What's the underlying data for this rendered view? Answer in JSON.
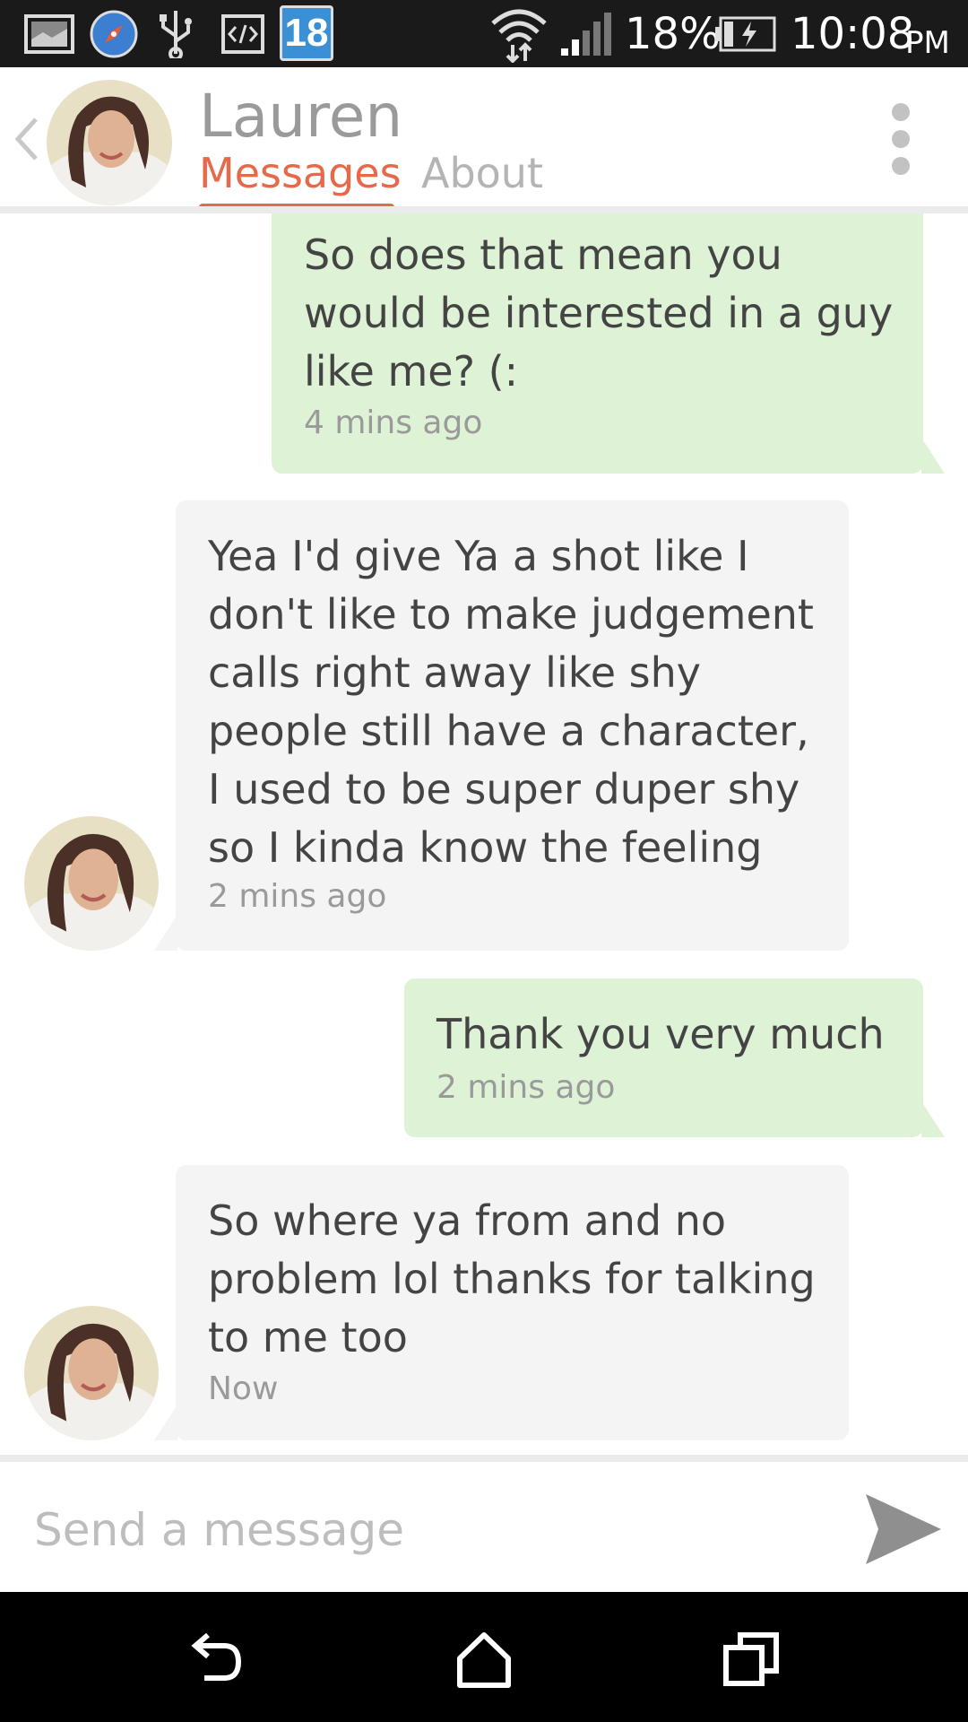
{
  "status_bar": {
    "notification_count": "18",
    "battery": "18%",
    "time": "10:08",
    "ampm": "PM"
  },
  "header": {
    "contact_name": "Lauren",
    "tabs": [
      {
        "label": "Messages",
        "active": true
      },
      {
        "label": "About",
        "active": false
      }
    ]
  },
  "messages": [
    {
      "direction": "sent",
      "text": "So does that mean you would be interested in a guy like me? (:",
      "time": "4 mins ago"
    },
    {
      "direction": "received",
      "text": "Yea I'd give Ya a shot like I don't like to make judgement calls right away like shy people still have a character, I used to be super duper shy so I kinda know the feeling",
      "time": "2 mins ago"
    },
    {
      "direction": "sent",
      "text": "Thank you very much",
      "time": "2 mins ago"
    },
    {
      "direction": "received",
      "text": "So where ya from and no problem lol thanks for talking to me too",
      "time": "Now"
    }
  ],
  "composer": {
    "placeholder": "Send a message",
    "value": ""
  },
  "colors": {
    "accent": "#e8684a",
    "sent_bubble": "#def2d6",
    "received_bubble": "#f4f4f4"
  }
}
